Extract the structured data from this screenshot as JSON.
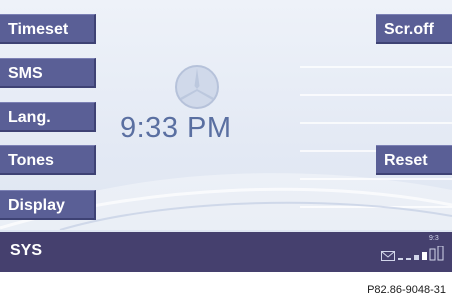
{
  "left_buttons": [
    {
      "label": "Timeset"
    },
    {
      "label": "SMS"
    },
    {
      "label": "Lang."
    },
    {
      "label": "Tones"
    },
    {
      "label": "Display"
    }
  ],
  "right_buttons": [
    {
      "label": "Scr.off"
    },
    {
      "label": "Reset"
    }
  ],
  "clock": {
    "time": "9:33 PM"
  },
  "status_bar": {
    "mode": "SYS",
    "time": "9:3",
    "icons": [
      "envelope-icon",
      "signal-strength-icon"
    ]
  },
  "figure_id": "P82.86-9048-31",
  "colors": {
    "button_bg": "#5a5f96",
    "status_bg": "#45406e",
    "clock_text": "#5a6fa1"
  }
}
